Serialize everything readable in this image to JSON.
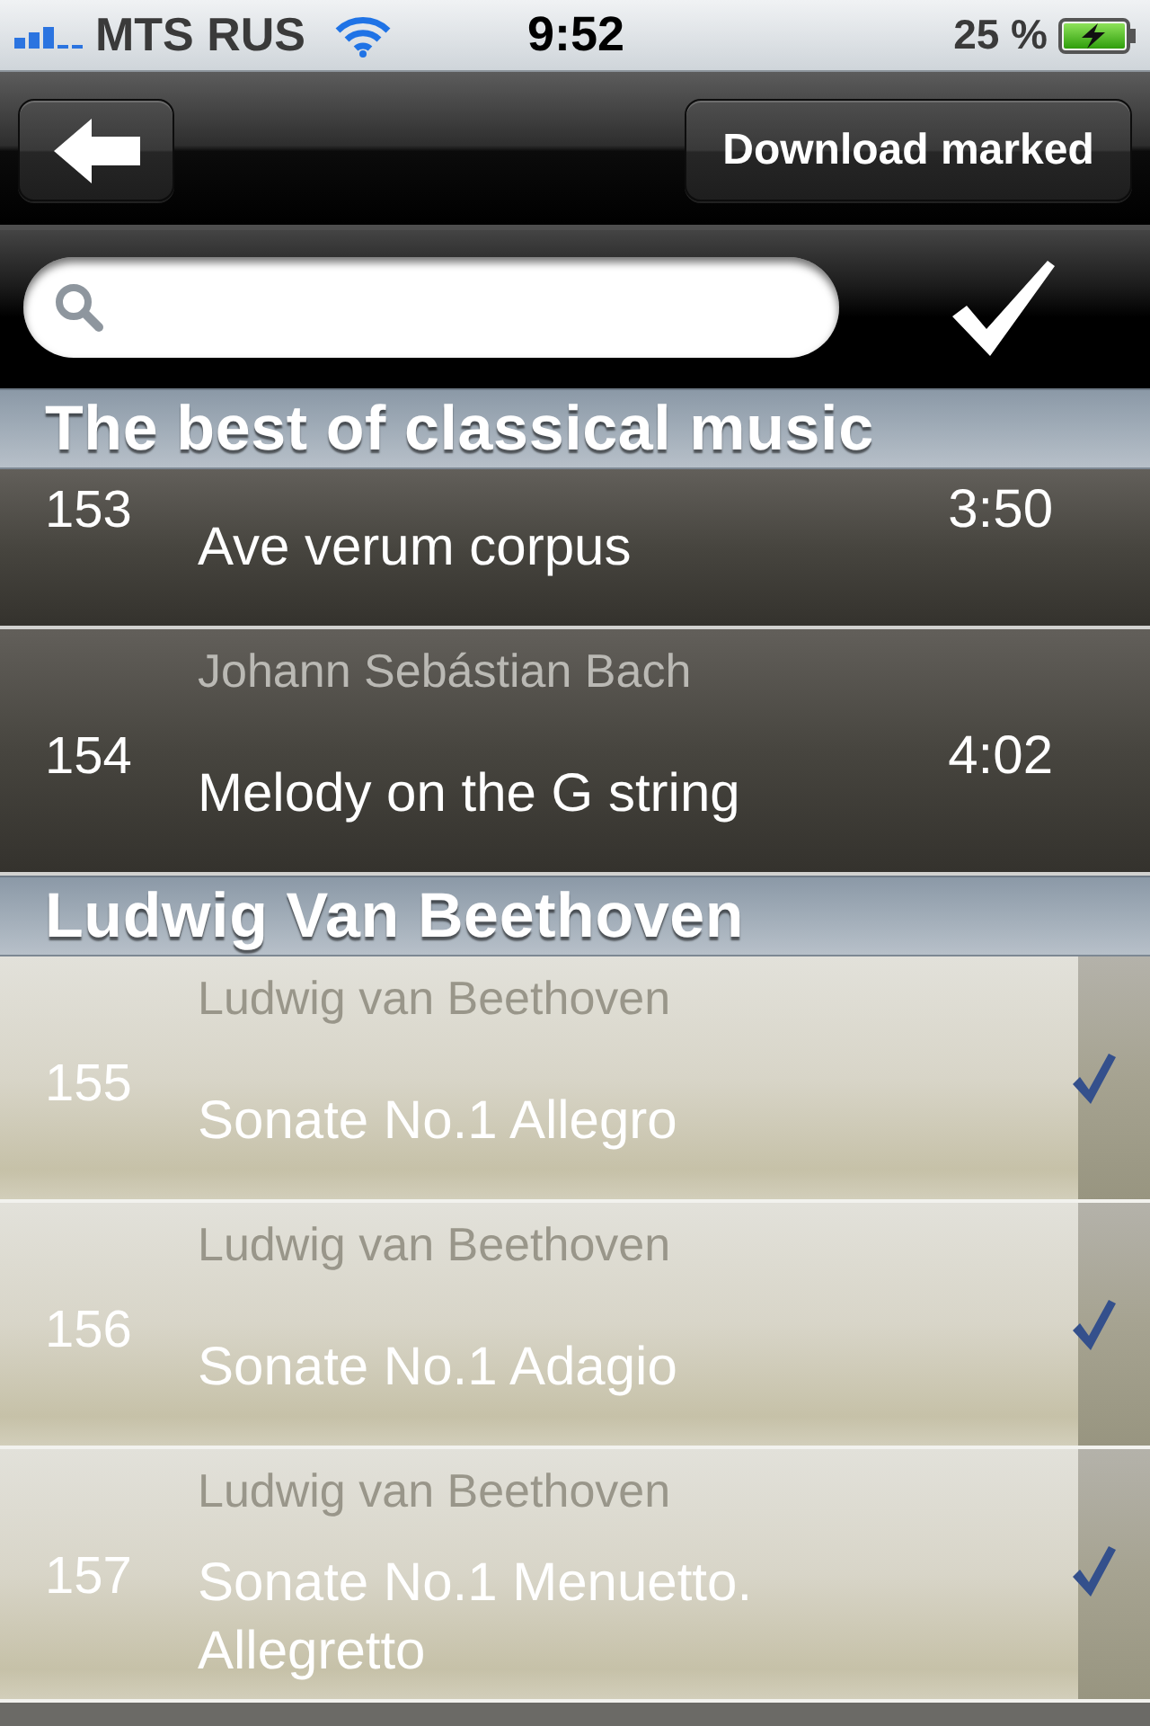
{
  "status_bar": {
    "carrier": "MTS RUS",
    "time": "9:52",
    "battery": "25 %",
    "charging": true
  },
  "nav_bar": {
    "download_button": "Download marked"
  },
  "sections": [
    {
      "title": "The best of classical music",
      "tracks": [
        {
          "number": "153",
          "title": "Ave verum corpus",
          "duration": "3:50",
          "checked": false
        },
        {
          "number": "154",
          "artist": "Johann Sebástian Bach",
          "title": "Melody on the G string",
          "duration": "4:02",
          "checked": false
        }
      ]
    },
    {
      "title": "Ludwig Van Beethoven",
      "tracks": [
        {
          "number": "155",
          "artist": "Ludwig van Beethoven",
          "title": "Sonate No.1 Allegro",
          "checked": true
        },
        {
          "number": "156",
          "artist": "Ludwig van Beethoven",
          "title": "Sonate No.1 Adagio",
          "checked": true
        },
        {
          "number": "157",
          "artist": "Ludwig van Beethoven",
          "title": "Sonate No.1 Menuetto. Allegretto",
          "checked": true
        }
      ]
    }
  ]
}
